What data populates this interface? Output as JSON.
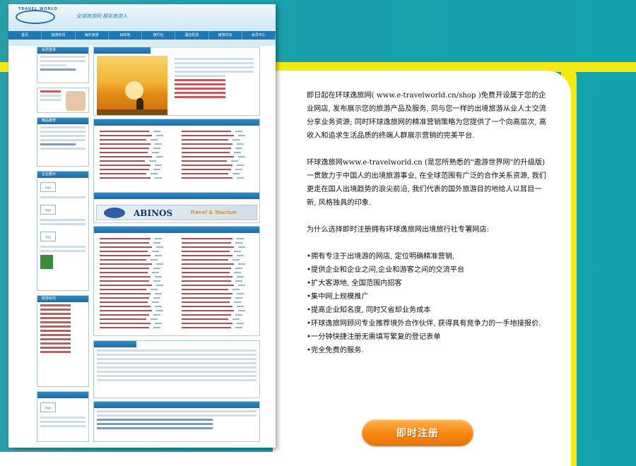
{
  "thumbnail": {
    "logo_text": "TRAVEL WORLD",
    "slogan": "全球旅游网 服务旅游人",
    "nav_items": [
      "首页",
      "旅游资讯",
      "海外旅游",
      "目的地",
      "旅行社",
      "酒店机票",
      "旅游论坛",
      "会员中心"
    ],
    "banner_brand": "ABINOS",
    "banner_tagline": "Travel & Tourism",
    "logo_placeholder": "logo",
    "sidebar_headers": [
      "会员登录",
      "精品推荐",
      "企业展示",
      "旅游资讯"
    ]
  },
  "intro": {
    "para1": "即日起在环球逸旅网( www.e-travelworld.cn/shop )免费开设属于您的企业网店, 发布展示您的旅游产品及服务, 同与您一样的出境旅游从业人士交流分享业务资源; 同时环球逸旅网的精准营销策略为您提供了一个向高层次, 高收入和追求生活品质的终端人群展示营销的完美平台.",
    "para2": "环球逸旅网www.e-travelworld.cn (是您所熟悉的\"遨游世界网\"的升级版)一贯致力于中国人的出境旅游事业, 在全球范围有广泛的合作关系资源, 我们更走在国人出境趋势的浪尖前沿, 我们代表的国外旅游目的地给人以耳目一新, 风格独具的印象.",
    "question": "为什么选择即时注册拥有环球逸旅网出境旅行社专署网店:"
  },
  "benefits": [
    "•拥有专注于出境游的网店, 定位明确精准营销,",
    "•提供企业和企业之间,企业和游客之间的交流平台",
    "•扩大客源地, 全国范围内招客",
    "•集中网上规模推广",
    "•提高企业知名度, 同时又省却业务成本",
    "•环球逸旅网顾问专业推荐境外合作伙伴, 获得具有竞争力的一手地接报价.",
    "•一分钟快捷注册无需填写繁复的登记表单",
    "•完全免费的服务."
  ],
  "register_button": "即时注册",
  "colors": {
    "teal": "#14a3ad",
    "yellow": "#f3ea12",
    "button_orange": "#f78a12"
  }
}
